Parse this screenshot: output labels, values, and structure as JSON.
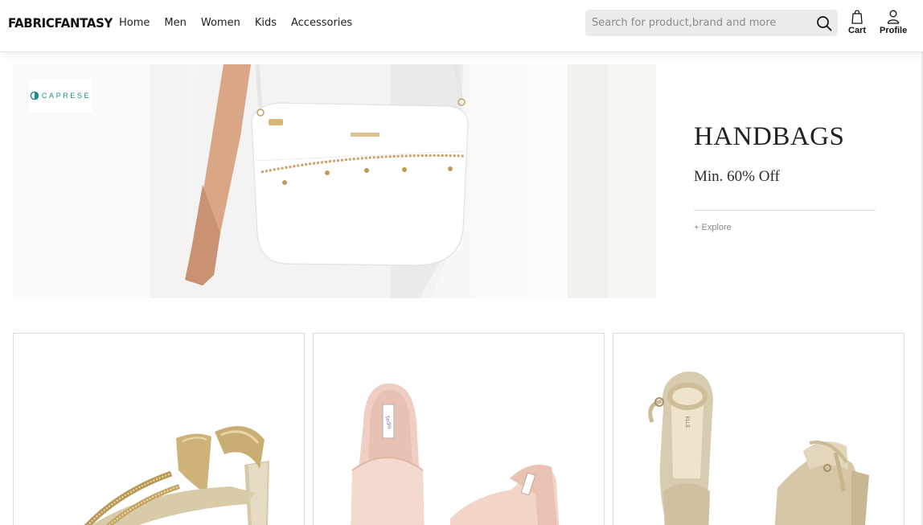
{
  "header": {
    "brand": "FABRICFANTASY",
    "nav": [
      "Home",
      "Men",
      "Women",
      "Kids",
      "Accessories"
    ],
    "search_placeholder": "Search for product,brand and more",
    "cart_label": "Cart",
    "profile_label": "Profile"
  },
  "banner": {
    "logo_text": "CAPRESE",
    "title": "HANDBAGS",
    "subtitle": "Min. 60% Off",
    "cta": "+ Explore"
  },
  "products": [
    {
      "image": "gold-strappy-heeled-sandal"
    },
    {
      "image": "pink-block-heel-mule"
    },
    {
      "image": "champagne-glitter-ankle-strap-heel"
    }
  ],
  "colors": {
    "accent": "#1e8e86",
    "search_bg": "#ececec",
    "card_border": "#dcdcdc"
  }
}
